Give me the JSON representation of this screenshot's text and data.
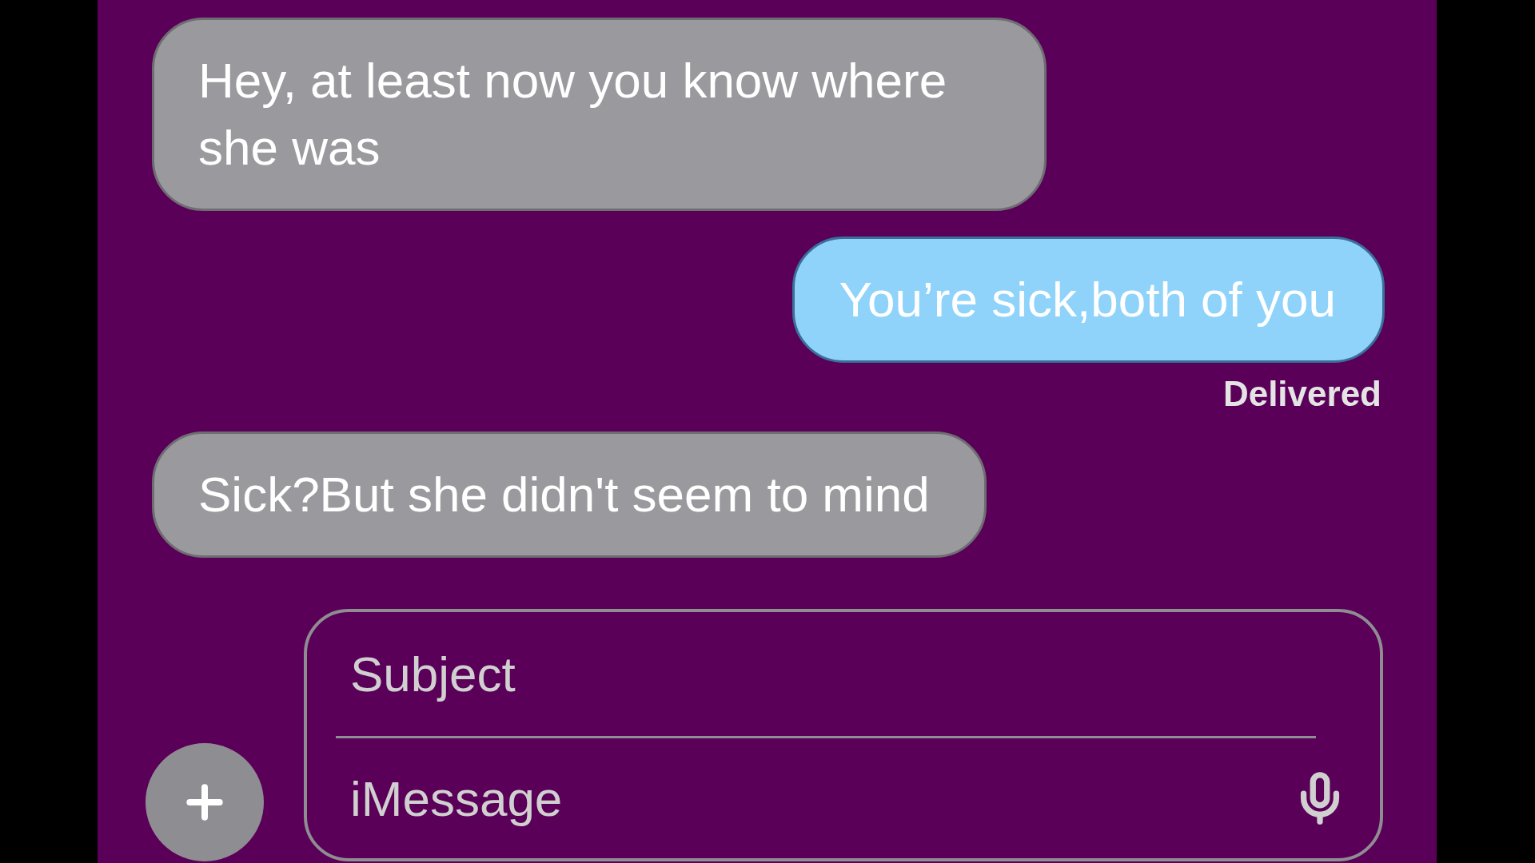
{
  "messages": [
    {
      "kind": "incoming",
      "text": "Hey, at least now you know where she was"
    },
    {
      "kind": "outgoing",
      "text": "You’re sick,both of you",
      "status": "Delivered"
    },
    {
      "kind": "incoming",
      "text": "Sick?But she didn't seem to mind"
    }
  ],
  "compose": {
    "subject_placeholder": "Subject",
    "message_placeholder": "iMessage"
  }
}
